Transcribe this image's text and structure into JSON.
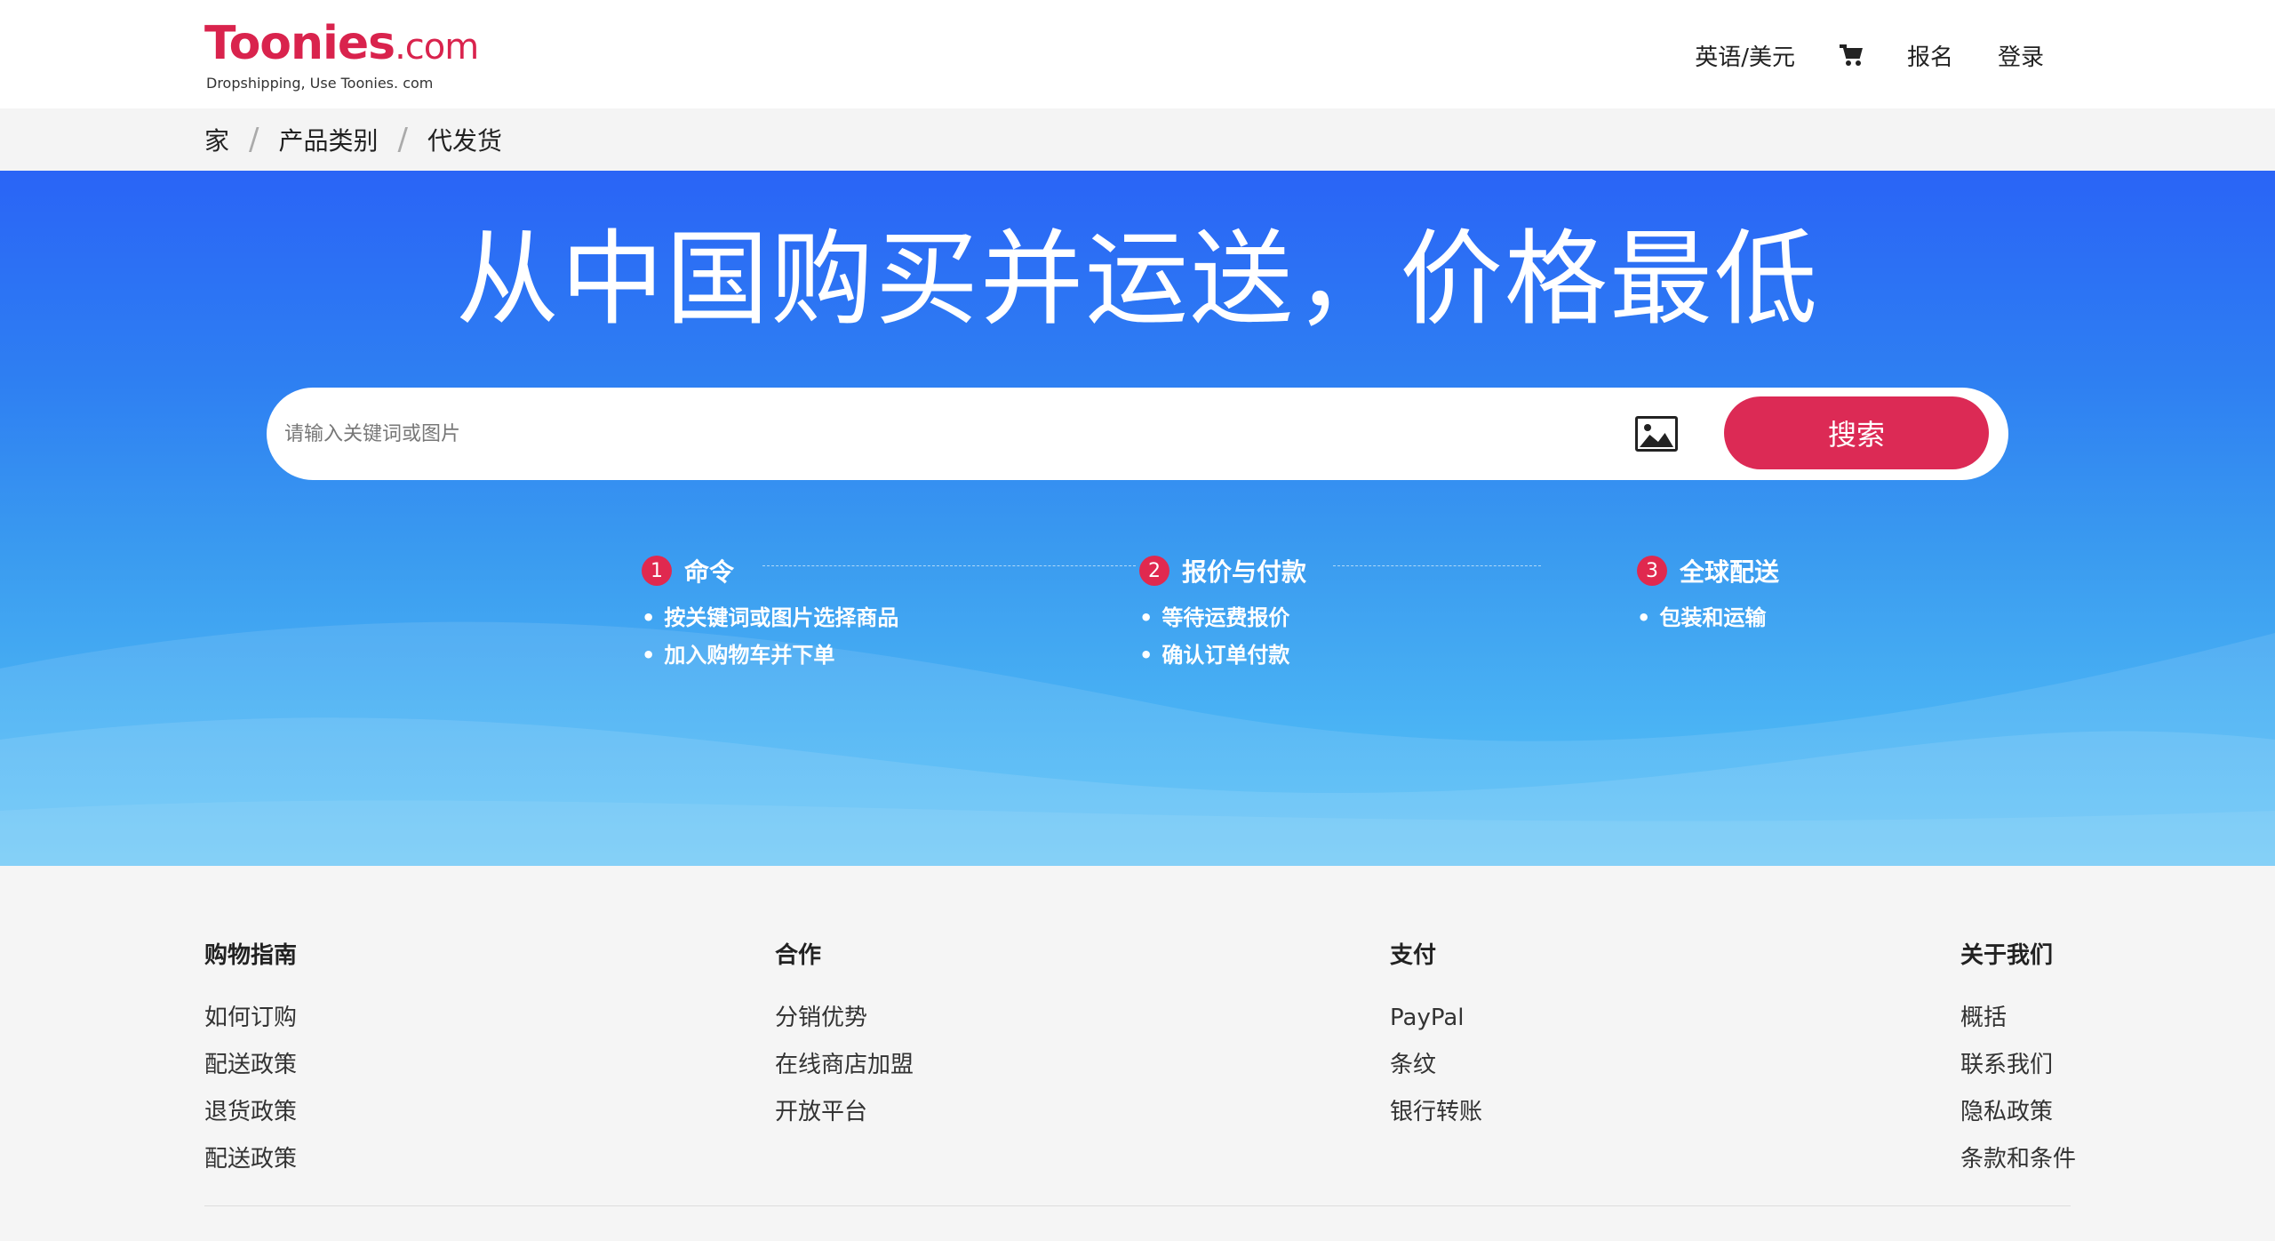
{
  "brand": {
    "logo_main": "Toonies",
    "logo_suffix": ".com",
    "tagline": "Dropshipping, Use Toonies. com",
    "accent_color": "#d9234d"
  },
  "topnav": {
    "language_currency": "英语/美元",
    "cart_icon": "shopping-cart-icon",
    "signup": "报名",
    "login": "登录"
  },
  "breadcrumb": {
    "items": [
      "家",
      "产品类别",
      "代发货"
    ],
    "separator": "/"
  },
  "hero": {
    "title": "从中国购买并运送，价格最低",
    "search": {
      "placeholder": "请输入关键词或图片",
      "value": "",
      "image_icon": "image-upload-icon",
      "button_label": "搜索",
      "button_color": "#dc2a55"
    },
    "steps": [
      {
        "number": "1",
        "title": "命令",
        "items": [
          "按关键词或图片选择商品",
          "加入购物车并下单"
        ]
      },
      {
        "number": "2",
        "title": "报价与付款",
        "items": [
          "等待运费报价",
          "确认订单付款"
        ]
      },
      {
        "number": "3",
        "title": "全球配送",
        "items": [
          "包装和运输"
        ]
      }
    ]
  },
  "footer": {
    "columns": [
      {
        "title": "购物指南",
        "links": [
          "如何订购",
          "配送政策",
          "退货政策",
          "配送政策"
        ]
      },
      {
        "title": "合作",
        "links": [
          "分销优势",
          "在线商店加盟",
          "开放平台"
        ]
      },
      {
        "title": "支付",
        "links": [
          "PayPal",
          "条纹",
          "银行转账"
        ]
      },
      {
        "title": "关于我们",
        "links": [
          "概括",
          "联系我们",
          "隐私政策",
          "条款和条件"
        ]
      }
    ]
  }
}
